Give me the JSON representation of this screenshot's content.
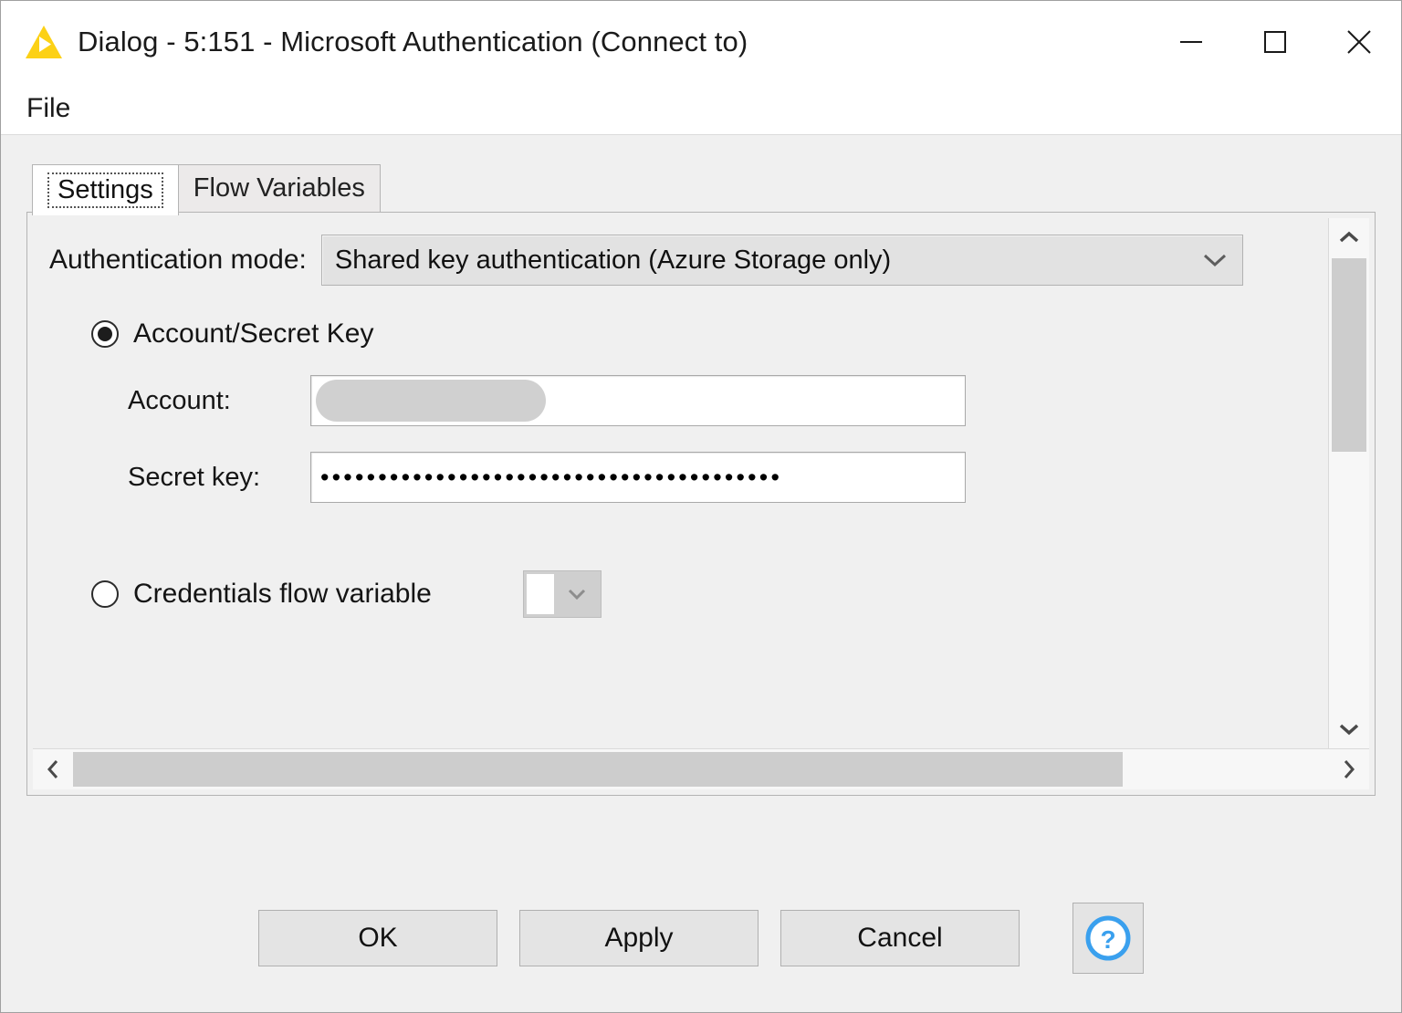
{
  "window": {
    "title": "Dialog - 5:151 - Microsoft Authentication (Connect to)",
    "app_icon": "knime-triangle-icon",
    "controls": {
      "minimize": "minimize-icon",
      "maximize": "maximize-icon",
      "close": "close-icon"
    }
  },
  "menubar": {
    "items": [
      {
        "label": "File"
      }
    ]
  },
  "tabs": [
    {
      "label": "Settings",
      "active": true
    },
    {
      "label": "Flow Variables",
      "active": false
    }
  ],
  "settings": {
    "auth_mode": {
      "label": "Authentication mode:",
      "value": "Shared key authentication (Azure Storage only)"
    },
    "options": [
      {
        "id": "account-secret-key",
        "label": "Account/Secret Key",
        "selected": true
      },
      {
        "id": "credentials-flow-variable",
        "label": "Credentials flow variable",
        "selected": false
      }
    ],
    "account": {
      "label": "Account:",
      "value": "",
      "redacted": true
    },
    "secret_key": {
      "label": "Secret key:",
      "value": "••••••••••••••••••••••••••••••••••••••••",
      "masked": true
    },
    "credentials_variable": {
      "value": "",
      "enabled": false
    }
  },
  "scrollbars": {
    "vertical": {
      "up": "chevron-up-icon",
      "down": "chevron-down-icon"
    },
    "horizontal": {
      "left": "chevron-left-icon",
      "right": "chevron-right-icon"
    }
  },
  "footer": {
    "ok": "OK",
    "apply": "Apply",
    "cancel": "Cancel",
    "help": "?"
  },
  "colors": {
    "brand_yellow": "#FCD116",
    "panel_bg": "#f0f0f0",
    "help_blue": "#3aa0ee",
    "scroll_thumb": "#cdcdcd"
  }
}
